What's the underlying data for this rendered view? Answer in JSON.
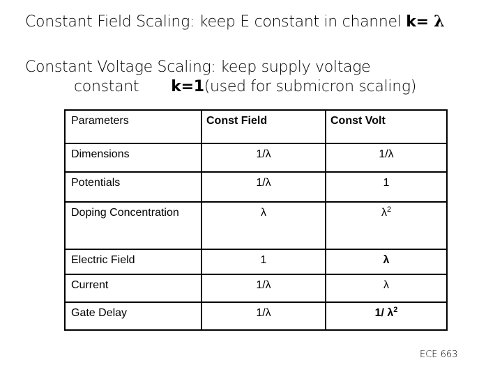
{
  "heading": {
    "line1": "Constant Field Scaling: keep E constant in channel ",
    "line1_k": "k= ",
    "line1_lambda": "λ",
    "line2": "Constant Voltage Scaling: keep supply voltage",
    "line3_a": "constant",
    "line3_k": "k=1",
    "line3_b": "(used for submicron scaling)"
  },
  "table": {
    "headers": [
      "Parameters",
      "Const Field",
      "Const Volt"
    ],
    "rows": [
      {
        "param": "Dimensions",
        "field": "1/λ",
        "volt": "1/λ"
      },
      {
        "param": "Potentials",
        "field": "1/λ",
        "volt": "1"
      },
      {
        "param": "Doping Concentration",
        "field": "λ",
        "volt": "λ",
        "volt_exp": "2"
      },
      {
        "param": "Electric Field",
        "field": "1",
        "volt": "λ"
      },
      {
        "param": "Current",
        "field": "1/λ",
        "volt": "λ"
      },
      {
        "param": "Gate Delay",
        "field": "1/λ",
        "volt": "1/ λ",
        "volt_exp": "2"
      }
    ]
  },
  "footer": {
    "course": "ECE 663"
  }
}
